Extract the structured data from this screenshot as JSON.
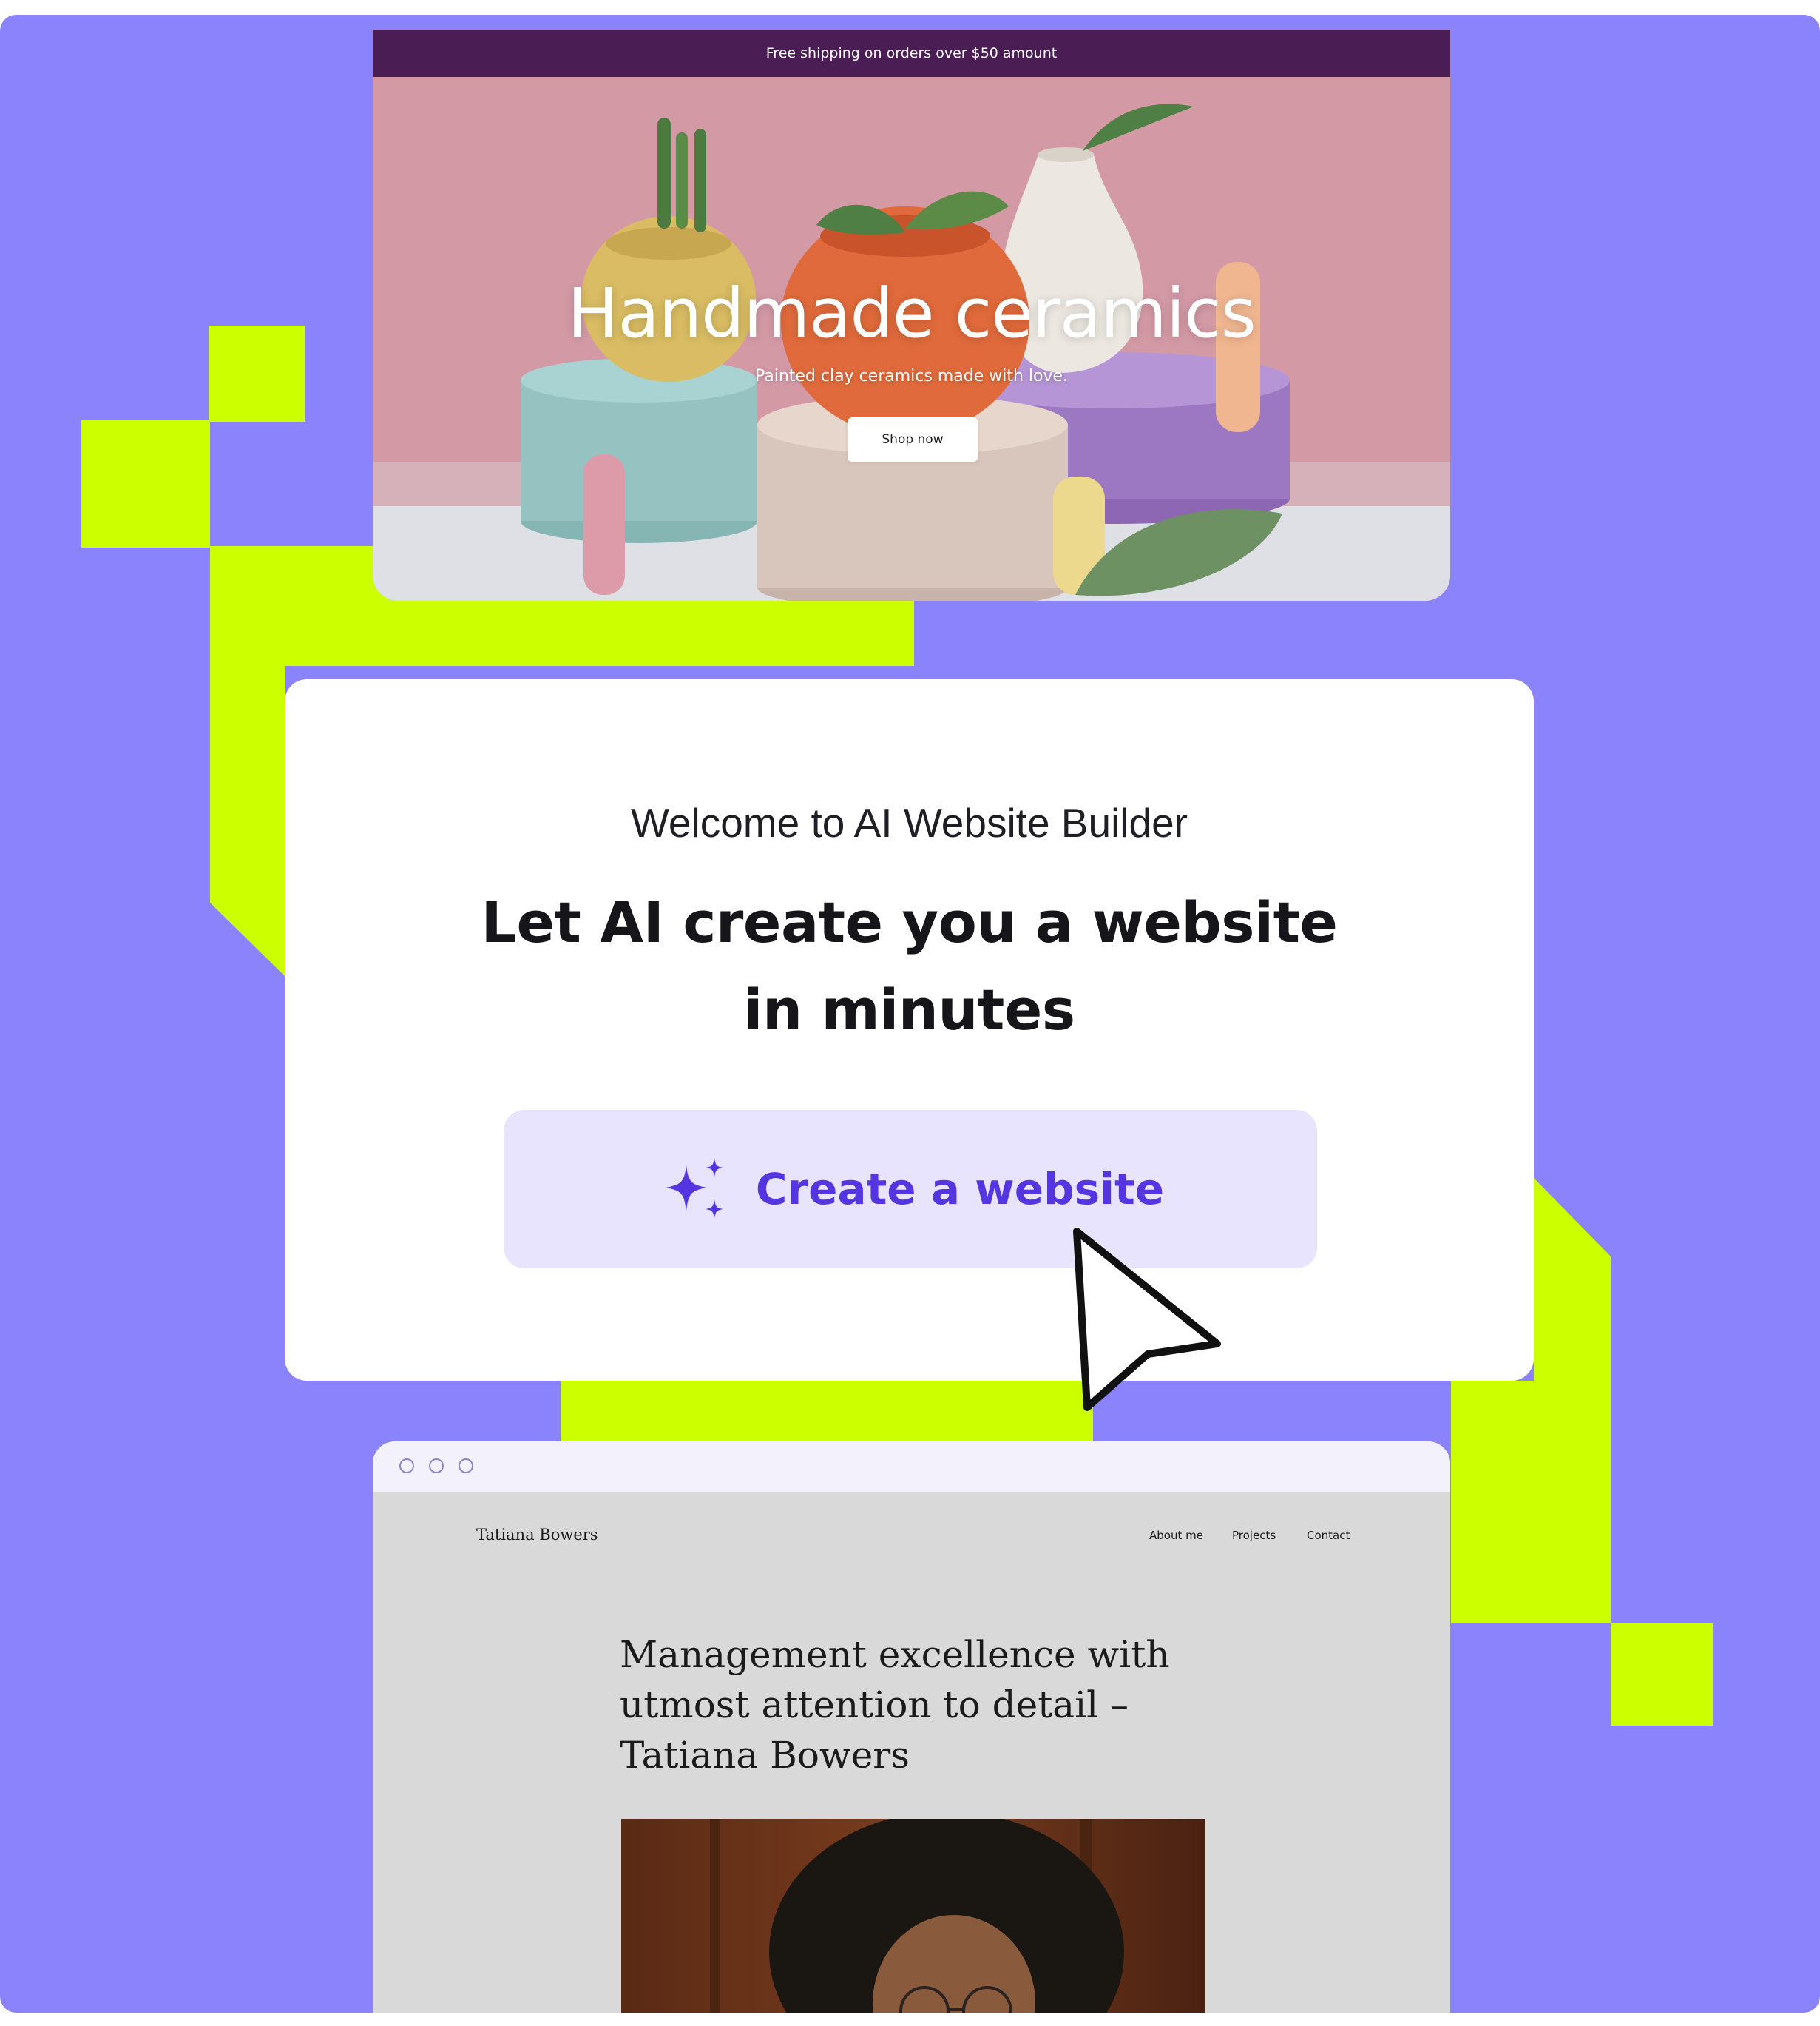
{
  "colors": {
    "background": "#8b83fc",
    "lime_accent": "#ccff00",
    "button_bg": "#e9e4fd",
    "button_text": "#5535e0",
    "ship_bar": "#4a1d55"
  },
  "ceramics_card": {
    "announcement": "Free shipping on orders over $50 amount",
    "title": "Handmade ceramics",
    "subtitle": "Painted clay ceramics made with love.",
    "cta": "Shop now"
  },
  "builder_card": {
    "welcome": "Welcome to AI Website Builder",
    "headline_line1": "Let AI create you a website",
    "headline_line2": "in minutes",
    "cta_label": "Create a website",
    "cta_icon": "sparkles-icon"
  },
  "cursor_icon": "arrow-cursor-icon",
  "portfolio_card": {
    "window_controls": [
      "circle",
      "circle",
      "circle"
    ],
    "site_name": "Tatiana Bowers",
    "nav": [
      "About me",
      "Projects",
      "Contact"
    ],
    "title_line1": "Management excellence with",
    "title_line2": "utmost attention to detail –",
    "title_line3": "Tatiana Bowers"
  }
}
